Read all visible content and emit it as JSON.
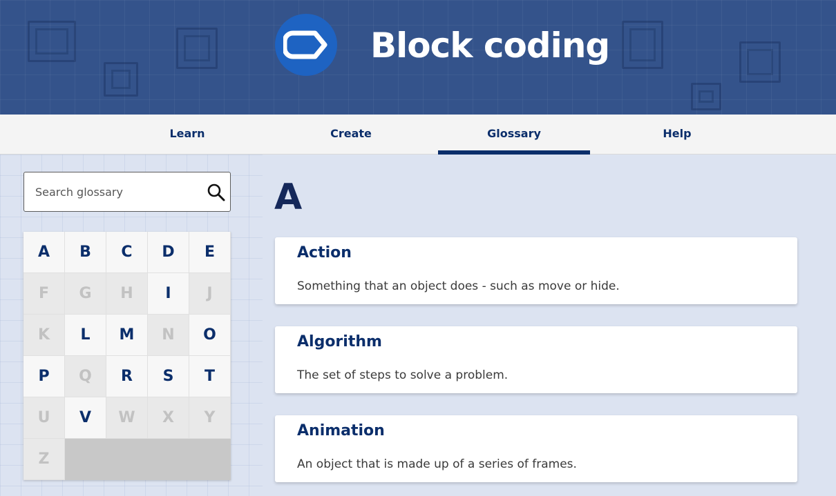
{
  "header": {
    "title": "Block coding",
    "logo_icon": "hexagon-block-icon",
    "brand_color": "#1e63c2"
  },
  "nav": {
    "tabs": [
      {
        "label": "Learn",
        "active": false
      },
      {
        "label": "Create",
        "active": false
      },
      {
        "label": "Glossary",
        "active": true
      },
      {
        "label": "Help",
        "active": false
      }
    ]
  },
  "search": {
    "placeholder": "Search glossary",
    "value": "",
    "icon": "search-icon"
  },
  "alphabet": [
    {
      "letter": "A",
      "enabled": true
    },
    {
      "letter": "B",
      "enabled": true
    },
    {
      "letter": "C",
      "enabled": true
    },
    {
      "letter": "D",
      "enabled": true
    },
    {
      "letter": "E",
      "enabled": true
    },
    {
      "letter": "F",
      "enabled": false
    },
    {
      "letter": "G",
      "enabled": false
    },
    {
      "letter": "H",
      "enabled": false
    },
    {
      "letter": "I",
      "enabled": true
    },
    {
      "letter": "J",
      "enabled": false
    },
    {
      "letter": "K",
      "enabled": false
    },
    {
      "letter": "L",
      "enabled": true
    },
    {
      "letter": "M",
      "enabled": true
    },
    {
      "letter": "N",
      "enabled": false
    },
    {
      "letter": "O",
      "enabled": true
    },
    {
      "letter": "P",
      "enabled": true
    },
    {
      "letter": "Q",
      "enabled": false
    },
    {
      "letter": "R",
      "enabled": true
    },
    {
      "letter": "S",
      "enabled": true
    },
    {
      "letter": "T",
      "enabled": true
    },
    {
      "letter": "U",
      "enabled": false
    },
    {
      "letter": "V",
      "enabled": true
    },
    {
      "letter": "W",
      "enabled": false
    },
    {
      "letter": "X",
      "enabled": false
    },
    {
      "letter": "Y",
      "enabled": false
    },
    {
      "letter": "Z",
      "enabled": false
    }
  ],
  "main": {
    "section_letter": "A",
    "entries": [
      {
        "term": "Action",
        "definition": "Something that an object does - such as move or hide."
      },
      {
        "term": "Algorithm",
        "definition": "The set of steps to solve a problem."
      },
      {
        "term": "Animation",
        "definition": "An object that is made up of a series of frames."
      }
    ]
  },
  "colors": {
    "navy": "#0b2e6b",
    "page_background": "#dce3f1",
    "header_background": "#34538b"
  }
}
